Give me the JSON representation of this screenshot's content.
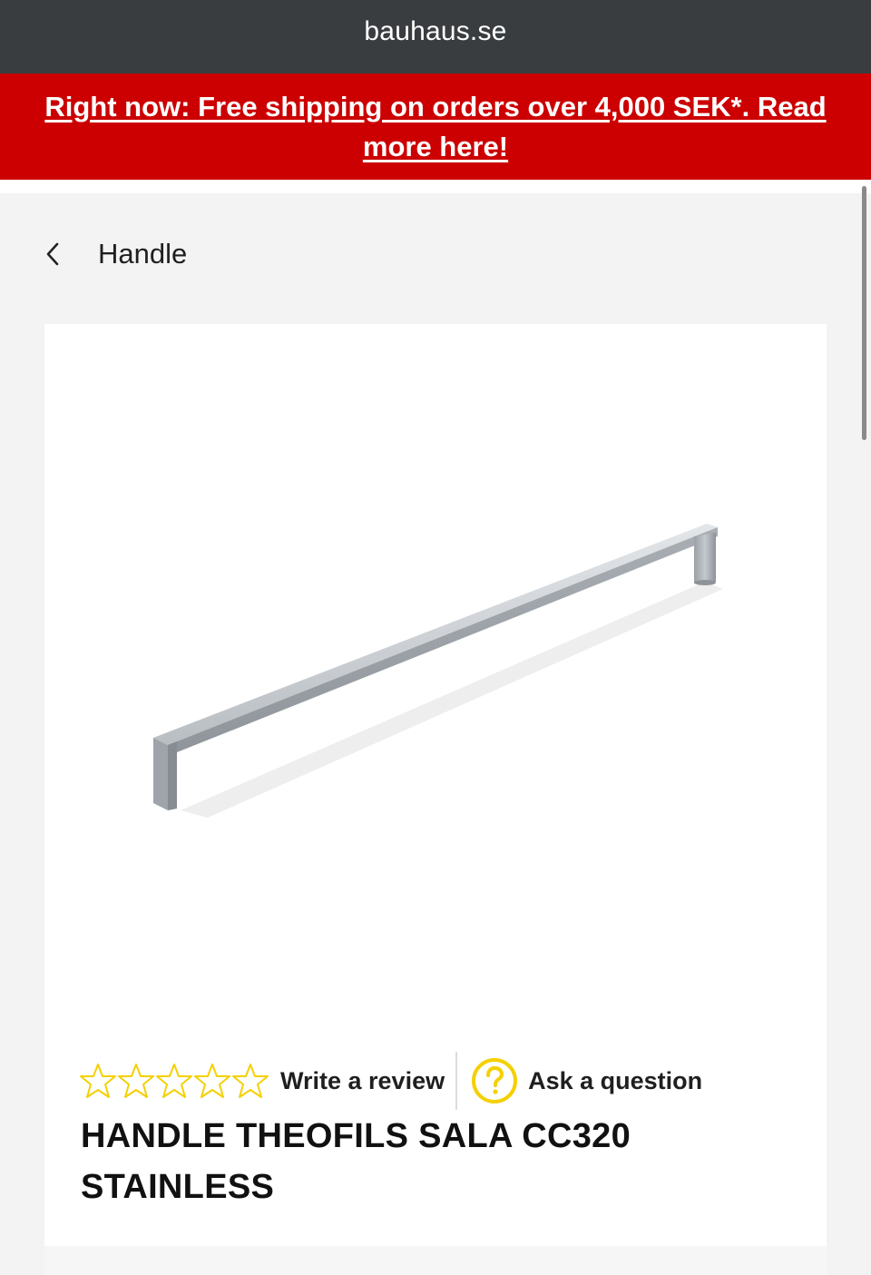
{
  "browser": {
    "domain": "bauhaus.se"
  },
  "promo": {
    "text": "Right now: Free shipping on orders over 4,000 SEK*. Read more here!"
  },
  "breadcrumb": {
    "back_icon": "chevron-left-icon",
    "label": "Handle"
  },
  "product": {
    "image_alt": "Stainless steel bar handle",
    "rating": {
      "stars_filled": 0,
      "stars_total": 5,
      "star_color": "#f5d000"
    },
    "write_review_label": "Write a review",
    "ask_question_icon": "question-circle-icon",
    "ask_question_label": "Ask a question",
    "title": "HANDLE THEOFILS SALA CC320 STAINLESS"
  },
  "colors": {
    "topbar": "#3a3d40",
    "promo_bg": "#cc0000",
    "accent_yellow": "#f5d000"
  }
}
